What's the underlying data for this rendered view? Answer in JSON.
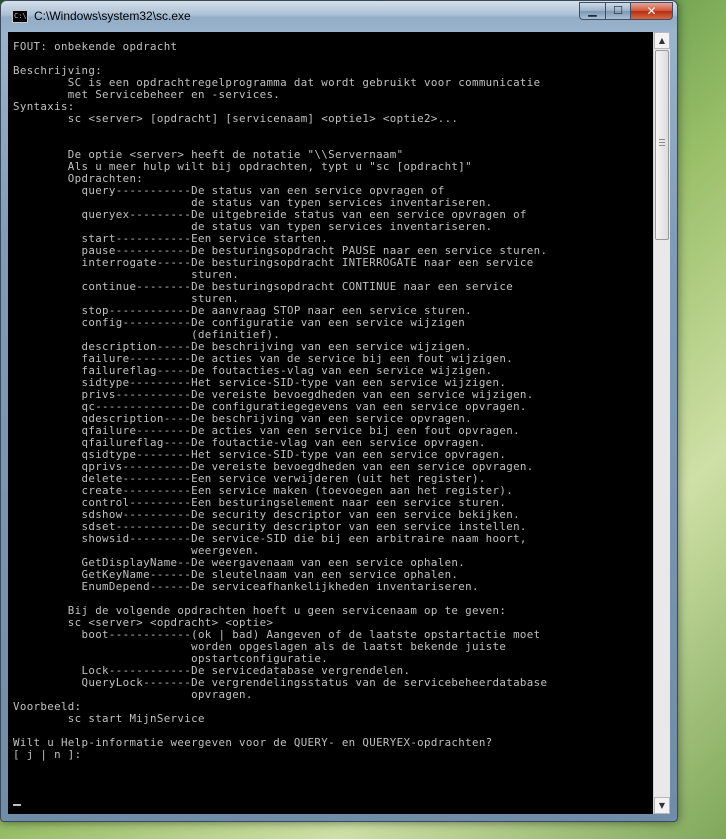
{
  "window": {
    "title": "C:\\Windows\\system32\\sc.exe",
    "icon": "console-app-icon",
    "controls": {
      "minimize": "minimize-icon",
      "maximize": "maximize-icon",
      "close": "close-icon"
    },
    "icon_glyphs": {
      "minimize": "▁",
      "maximize": "☐",
      "close": "✕"
    },
    "colors": {
      "console_bg": "#000000",
      "console_fg": "#c0c0c0",
      "close_button": "#c43b1e"
    }
  },
  "scrollbar": {
    "up": "▲",
    "down": "▼"
  },
  "console": {
    "lines": [
      "FOUT: onbekende opdracht",
      "",
      "Beschrijving:",
      "        SC is een opdrachtregelprogramma dat wordt gebruikt voor communicatie",
      "        met Servicebeheer en -services.",
      "Syntaxis:",
      "        sc <server> [opdracht] [servicenaam] <optie1> <optie2>...",
      "",
      "",
      "        De optie <server> heeft de notatie \"\\\\Servernaam\"",
      "        Als u meer hulp wilt bij opdrachten, typt u \"sc [opdracht]\"",
      "        Opdrachten:",
      "          query-----------De status van een service opvragen of",
      "                          de status van typen services inventariseren.",
      "          queryex---------De uitgebreide status van een service opvragen of",
      "                          de status van typen services inventariseren.",
      "          start-----------Een service starten.",
      "          pause-----------De besturingsopdracht PAUSE naar een service sturen.",
      "          interrogate-----De besturingsopdracht INTERROGATE naar een service",
      "                          sturen.",
      "          continue--------De besturingsopdracht CONTINUE naar een service",
      "                          sturen.",
      "          stop------------De aanvraag STOP naar een service sturen.",
      "          config----------De configuratie van een service wijzigen",
      "                          (definitief).",
      "          description-----De beschrijving van een service wijzigen.",
      "          failure---------De acties van de service bij een fout wijzigen.",
      "          failureflag-----De foutacties-vlag van een service wijzigen.",
      "          sidtype---------Het service-SID-type van een service wijzigen.",
      "          privs-----------De vereiste bevoegdheden van een service wijzigen.",
      "          qc--------------De configuratiegegevens van een service opvragen.",
      "          qdescription----De beschrijving van een service opvragen.",
      "          qfailure--------De acties van een service bij een fout opvragen.",
      "          qfailureflag----De foutactie-vlag van een service opvragen.",
      "          qsidtype--------Het service-SID-type van een service opvragen.",
      "          qprivs----------De vereiste bevoegdheden van een service opvragen.",
      "          delete----------Een service verwijderen (uit het register).",
      "          create----------Een service maken (toevoegen aan het register).",
      "          control---------Een besturingselement naar een service sturen.",
      "          sdshow----------De security descriptor van een service bekijken.",
      "          sdset-----------De security descriptor van een service instellen.",
      "          showsid---------De service-SID die bij een arbitraire naam hoort,",
      "                          weergeven.",
      "          GetDisplayName--De weergavenaam van een service ophalen.",
      "          GetKeyName------De sleutelnaam van een service ophalen.",
      "          EnumDepend------De serviceafhankelijkheden inventariseren.",
      "",
      "        Bij de volgende opdrachten hoeft u geen servicenaam op te geven:",
      "        sc <server> <opdracht> <optie>",
      "          boot------------(ok | bad) Aangeven of de laatste opstartactie moet",
      "                          worden opgeslagen als de laatst bekende juiste",
      "                          opstartconfiguratie.",
      "          Lock------------De servicedatabase vergrendelen.",
      "          QueryLock-------De vergrendelingsstatus van de servicebeheerdatabase",
      "                          opvragen.",
      "Voorbeeld:",
      "        sc start MijnService",
      "",
      "Wilt u Help-informatie weergeven voor de QUERY- en QUERYEX-opdrachten?",
      "[ j | n ]:"
    ]
  }
}
